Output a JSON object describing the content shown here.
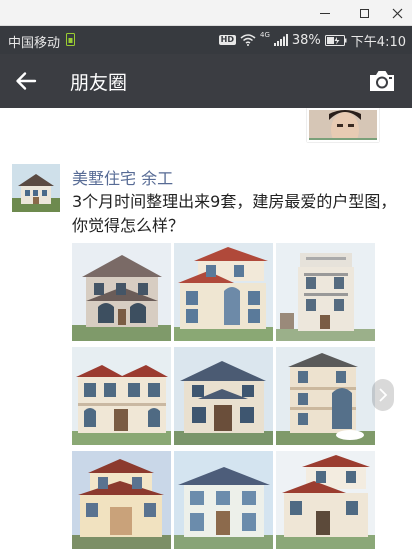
{
  "window": {
    "minimize": "minimize",
    "maximize": "maximize",
    "close": "close"
  },
  "status_bar": {
    "carrier": "中国移动",
    "hd": "HD",
    "network": "4G",
    "battery": "38%",
    "time": "下午4:10"
  },
  "app_bar": {
    "title": "朋友圈"
  },
  "post": {
    "author": "美墅住宅  余工",
    "text": "3个月时间整理出来9套，建房最爱的户型图，你觉得怎么样？",
    "photos": [
      "villa-1",
      "villa-2",
      "villa-3",
      "villa-4",
      "villa-5",
      "villa-6",
      "villa-7",
      "villa-8",
      "villa-9"
    ]
  },
  "colors": {
    "status_bar": "#373a3f",
    "app_bar": "#3b3d42",
    "name_link": "#576b95"
  }
}
